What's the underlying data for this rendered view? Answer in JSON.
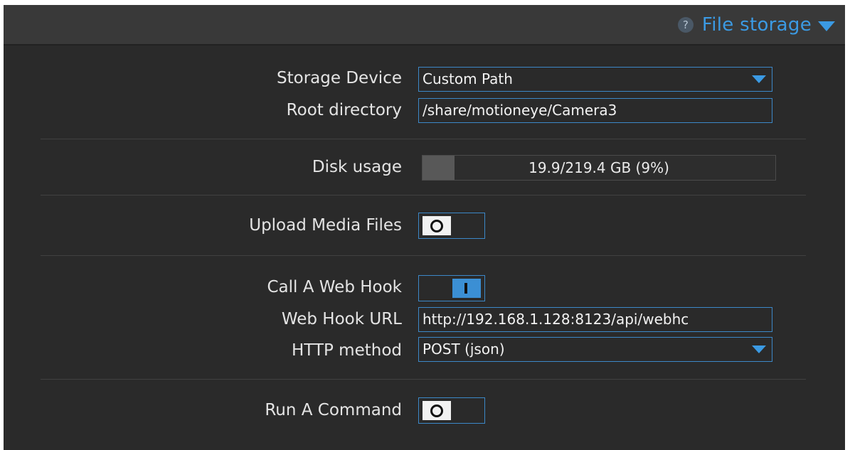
{
  "header": {
    "help_icon": "?",
    "title": "File storage"
  },
  "storage_device": {
    "label": "Storage Device",
    "value": "Custom Path"
  },
  "root_directory": {
    "label": "Root directory",
    "value": "/share/motioneye/Camera3"
  },
  "disk_usage": {
    "label": "Disk usage",
    "text": "19.9/219.4 GB (9%)",
    "percent": 9
  },
  "upload_media": {
    "label": "Upload Media Files",
    "enabled": false
  },
  "web_hook": {
    "label": "Call A Web Hook",
    "enabled": true,
    "url_label": "Web Hook URL",
    "url_value": "http://192.168.1.128:8123/api/webhc",
    "method_label": "HTTP method",
    "method_value": "POST (json)"
  },
  "run_command": {
    "label": "Run A Command",
    "enabled": false
  },
  "colors": {
    "accent": "#3b9ae3",
    "panel_bg": "#2a2a2a",
    "header_bg": "#393939"
  }
}
